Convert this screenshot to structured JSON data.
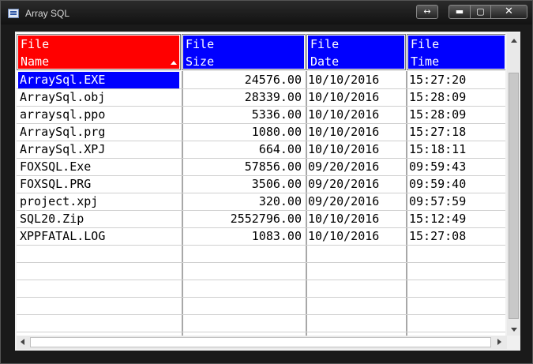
{
  "window": {
    "title": "Array SQL"
  },
  "titlebar": {
    "resize_glyph": "↔",
    "minimize_glyph": "▬",
    "maximize_glyph": "▢",
    "close_glyph": "✕"
  },
  "grid": {
    "columns": [
      {
        "line1": "File",
        "line2": "Name",
        "color": "#ff0000",
        "sorted": "ascending"
      },
      {
        "line1": "File",
        "line2": "Size",
        "color": "#0000ff"
      },
      {
        "line1": "File",
        "line2": "Date",
        "color": "#0000ff"
      },
      {
        "line1": "File",
        "line2": "Time",
        "color": "#0000ff"
      }
    ],
    "selected_row": 0,
    "rows": [
      [
        "ArraySql.EXE",
        "24576.00",
        "10/10/2016",
        "15:27:20"
      ],
      [
        "ArraySql.obj",
        "28339.00",
        "10/10/2016",
        "15:28:09"
      ],
      [
        "arraysql.ppo",
        "5336.00",
        "10/10/2016",
        "15:28:09"
      ],
      [
        "ArraySql.prg",
        "1080.00",
        "10/10/2016",
        "15:27:18"
      ],
      [
        "ArraySql.XPJ",
        "664.00",
        "10/10/2016",
        "15:18:11"
      ],
      [
        "FOXSQL.Exe",
        "57856.00",
        "09/20/2016",
        "09:59:43"
      ],
      [
        "FOXSQL.PRG",
        "3506.00",
        "09/20/2016",
        "09:59:40"
      ],
      [
        "project.xpj",
        "320.00",
        "09/20/2016",
        "09:57:59"
      ],
      [
        "SQL20.Zip",
        "2552796.00",
        "10/10/2016",
        "15:12:49"
      ],
      [
        "XPPFATAL.LOG",
        "1083.00",
        "10/10/2016",
        "15:27:08"
      ]
    ]
  }
}
